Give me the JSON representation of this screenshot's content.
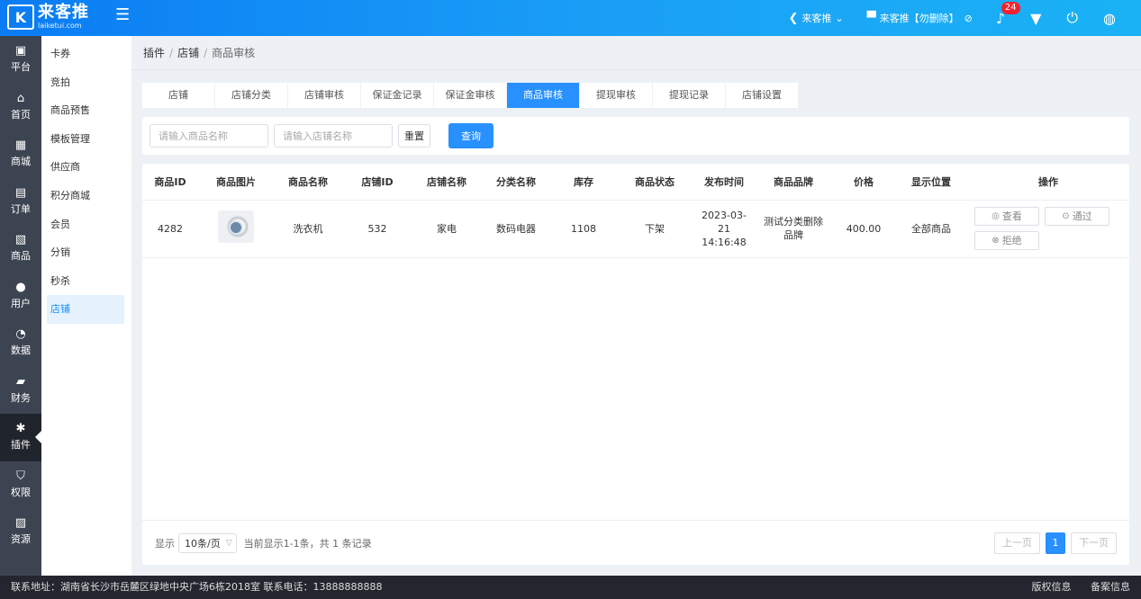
{
  "app": {
    "logo_mark": "K",
    "name": "来客推",
    "url": "laiketui.com"
  },
  "topbar": {
    "store_switch": "来客推",
    "store_name": "来客推【勿删除】",
    "notifications_count": "24"
  },
  "rail": [
    {
      "label": "平台",
      "icon": "platform-icon",
      "glyph": "▣"
    },
    {
      "label": "首页",
      "icon": "home-icon",
      "glyph": "⌂"
    },
    {
      "label": "商城",
      "icon": "mall-icon",
      "glyph": "▦"
    },
    {
      "label": "订单",
      "icon": "order-icon",
      "glyph": "▤"
    },
    {
      "label": "商品",
      "icon": "product-icon",
      "glyph": "▧"
    },
    {
      "label": "用户",
      "icon": "user-icon",
      "glyph": "●"
    },
    {
      "label": "数据",
      "icon": "chart-icon",
      "glyph": "◔"
    },
    {
      "label": "财务",
      "icon": "wallet-icon",
      "glyph": "▰"
    },
    {
      "label": "插件",
      "icon": "puzzle-icon",
      "glyph": "✱"
    },
    {
      "label": "权限",
      "icon": "shield-icon",
      "glyph": "⛉"
    },
    {
      "label": "资源",
      "icon": "image-icon",
      "glyph": "▨"
    }
  ],
  "submenu": [
    "卡券",
    "竞拍",
    "商品预售",
    "模板管理",
    "供应商",
    "积分商城",
    "会员",
    "分销",
    "秒杀",
    "店铺"
  ],
  "breadcrumb": [
    "插件",
    "店铺",
    "商品审核"
  ],
  "tabs": [
    "店铺",
    "店铺分类",
    "店铺审核",
    "保证金记录",
    "保证金审核",
    "商品审核",
    "提现审核",
    "提现记录",
    "店铺设置"
  ],
  "filter": {
    "product_placeholder": "请输入商品名称",
    "store_placeholder": "请输入店铺名称",
    "reset_label": "重置",
    "query_label": "查询"
  },
  "table": {
    "columns": [
      "商品ID",
      "商品图片",
      "商品名称",
      "店铺ID",
      "店铺名称",
      "分类名称",
      "库存",
      "商品状态",
      "发布时间",
      "商品品牌",
      "价格",
      "显示位置",
      "操作"
    ],
    "rows": [
      {
        "id": "4282",
        "name": "洗衣机",
        "store_id": "532",
        "store_name": "家电",
        "category": "数码电器",
        "stock": "1108",
        "status": "下架",
        "published": "2023-03-21 14:16:48",
        "brand": "测试分类删除品牌",
        "price": "400.00",
        "position": "全部商品"
      }
    ],
    "actions": {
      "view": "查看",
      "approve": "通过",
      "reject": "拒绝"
    }
  },
  "pagination": {
    "show_label": "显示",
    "page_size": "10条/页",
    "summary": "当前显示1-1条，共 1 条记录",
    "prev": "上一页",
    "current": "1",
    "next": "下一页"
  },
  "footer": {
    "address": "联系地址：湖南省长沙市岳麓区绿地中央广场6栋2018室 联系电话：13888888888",
    "copyright": "版权信息",
    "record": "备案信息"
  }
}
